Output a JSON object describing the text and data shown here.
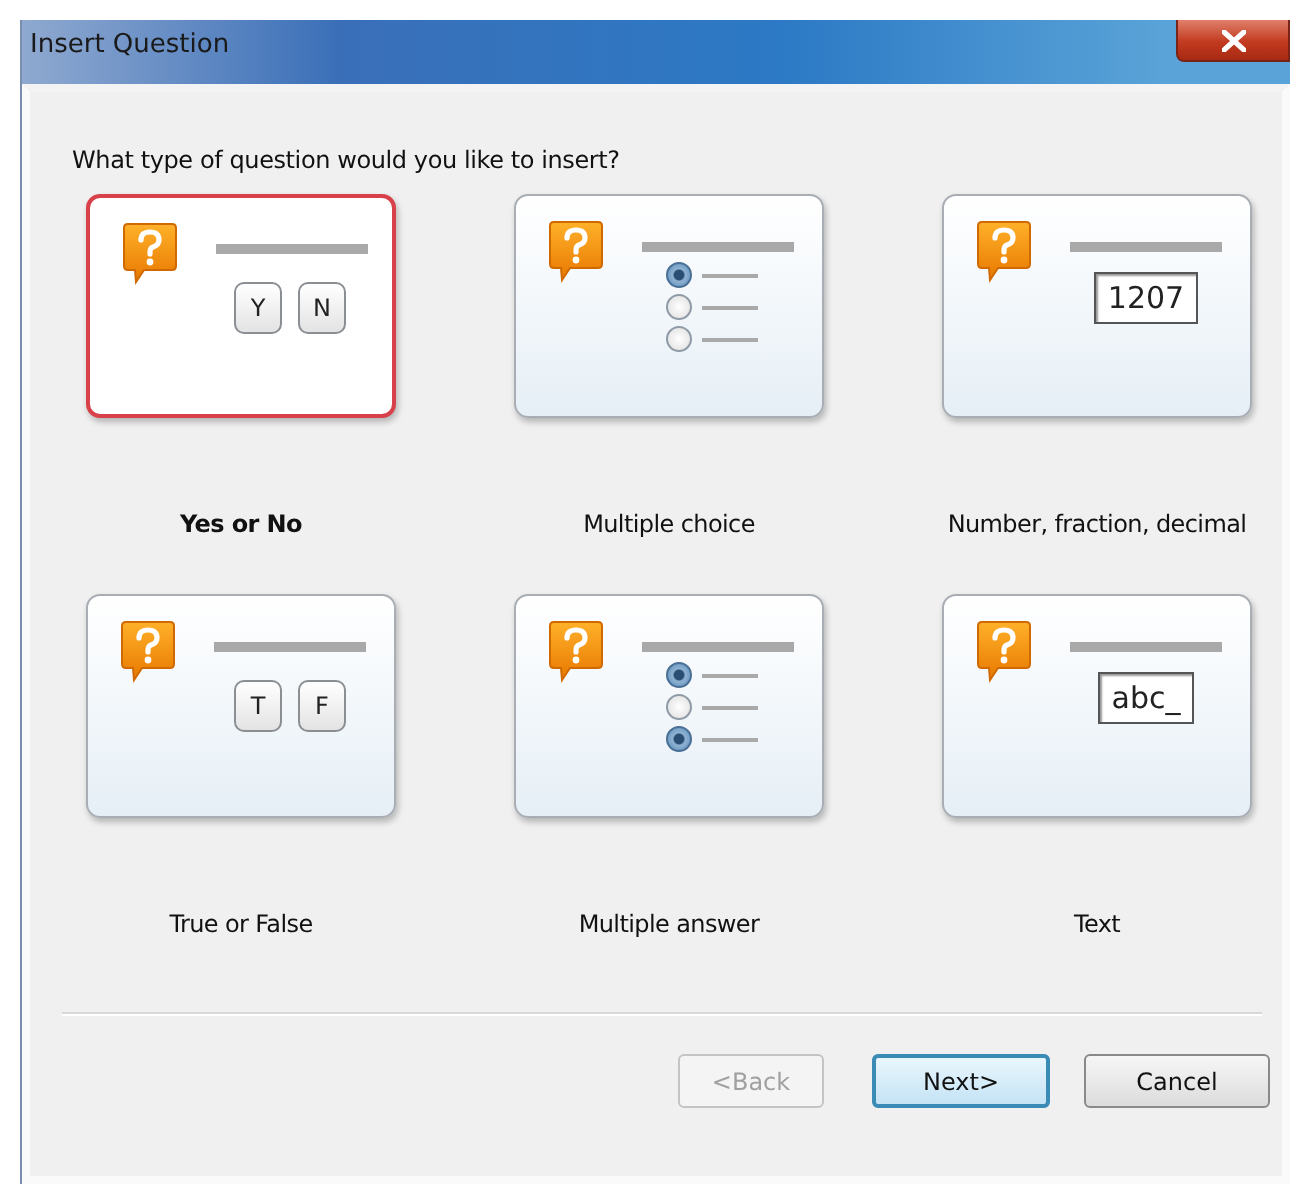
{
  "window": {
    "title": "Insert Question"
  },
  "prompt": "What type of question would you like to insert?",
  "options": [
    {
      "label": "Yes or No",
      "selected": true,
      "kind": "keys",
      "keys": [
        "Y",
        "N"
      ]
    },
    {
      "label": "Multiple choice",
      "selected": false,
      "kind": "radios",
      "radios": [
        {
          "checked": true
        },
        {
          "checked": false
        },
        {
          "checked": false
        }
      ]
    },
    {
      "label": "Number, fraction, decimal",
      "selected": false,
      "kind": "field",
      "value": "1207"
    },
    {
      "label": "True or False",
      "selected": false,
      "kind": "keys",
      "keys": [
        "T",
        "F"
      ]
    },
    {
      "label": "Multiple answer",
      "selected": false,
      "kind": "radios",
      "radios": [
        {
          "checked": true
        },
        {
          "checked": false
        },
        {
          "checked": true
        }
      ]
    },
    {
      "label": "Text",
      "selected": false,
      "kind": "field",
      "value": "abc_"
    }
  ],
  "buttons": [
    {
      "label": "<Back",
      "disabled": true,
      "default": false
    },
    {
      "label": "Next>",
      "disabled": false,
      "default": true
    },
    {
      "label": "Cancel",
      "disabled": false,
      "default": false
    }
  ]
}
